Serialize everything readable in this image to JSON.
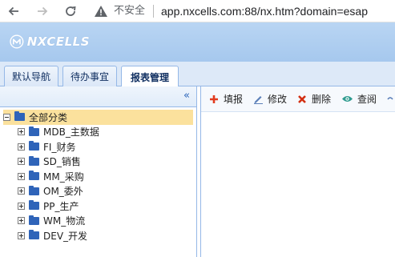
{
  "browser": {
    "insecure_label": "不安全",
    "url": "app.nxcells.com:88/nx.htm?domain=esap"
  },
  "app": {
    "logo_text": "NXCELLS"
  },
  "tabs": [
    {
      "label": "默认导航"
    },
    {
      "label": "待办事宜"
    },
    {
      "label": "报表管理"
    }
  ],
  "left_panel": {
    "collapse_icon": "«"
  },
  "tree": {
    "root": "全部分类",
    "items": [
      {
        "label": "MDB_主数据"
      },
      {
        "label": "FI_财务"
      },
      {
        "label": "SD_销售"
      },
      {
        "label": "MM_采购"
      },
      {
        "label": "OM_委外"
      },
      {
        "label": "PP_生产"
      },
      {
        "label": "WM_物流"
      },
      {
        "label": "DEV_开发"
      }
    ]
  },
  "toolbar": {
    "fill": {
      "label": "填报",
      "icon": "+",
      "color": "#e23b1e"
    },
    "edit": {
      "label": "修改",
      "icon": "pencil",
      "color": "#5b7fb8"
    },
    "delete": {
      "label": "删除",
      "icon": "×",
      "color": "#d32f12"
    },
    "view": {
      "label": "查阅",
      "icon": "eye",
      "color": "#2e9b8f"
    }
  }
}
